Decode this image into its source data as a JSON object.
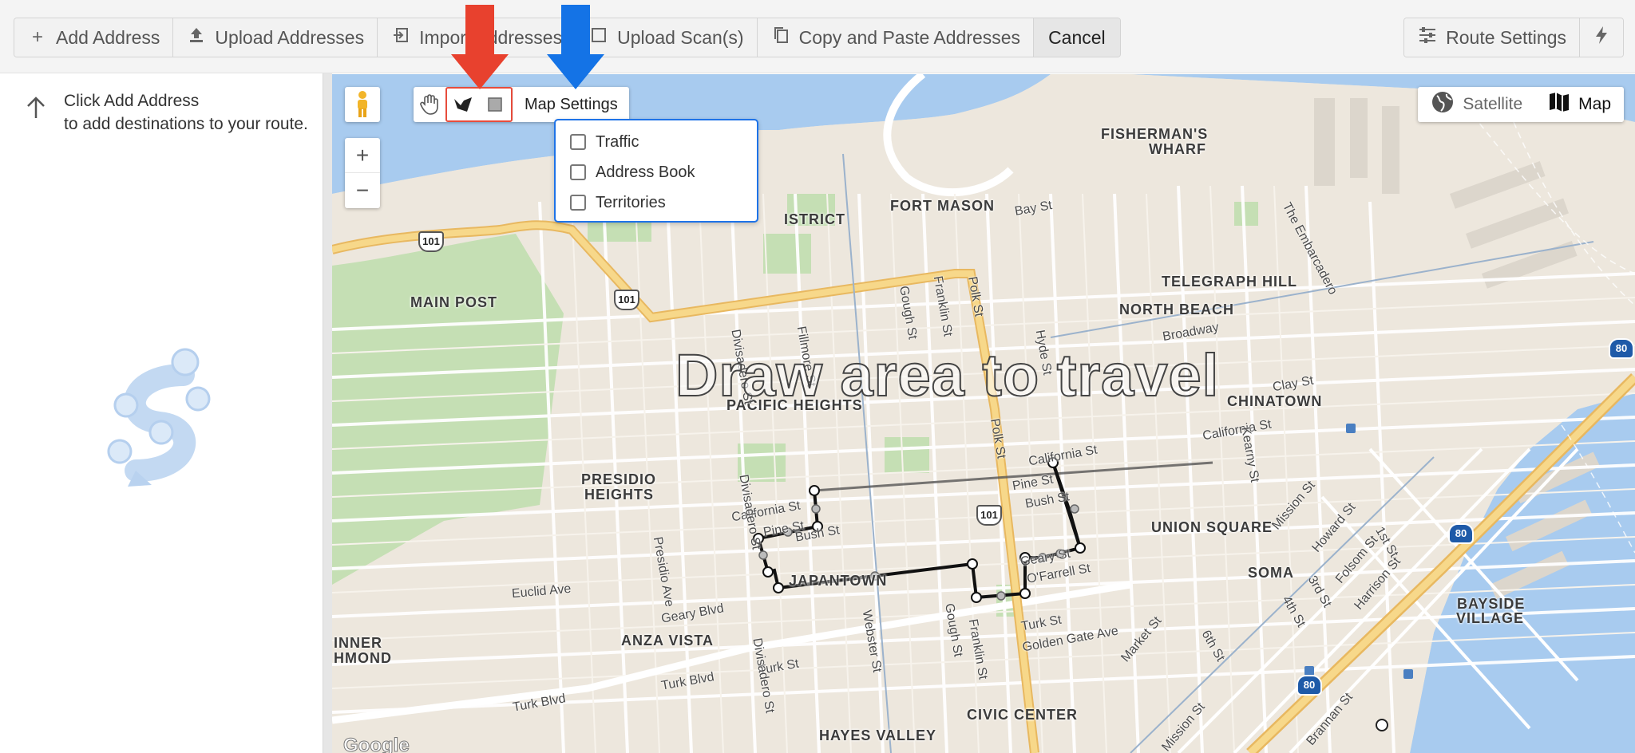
{
  "toolbar": {
    "add_address": "Add Address",
    "upload_addresses": "Upload Addresses",
    "import_addresses": "Import Addresses",
    "upload_scans": "Upload Scan(s)",
    "copy_paste": "Copy and Paste Addresses",
    "cancel": "Cancel",
    "route_settings": "Route Settings"
  },
  "left_panel": {
    "hint_line1": "Click Add Address",
    "hint_line2": "to add destinations to your route."
  },
  "map": {
    "overlay_text": "Draw area to travel",
    "map_settings": "Map Settings",
    "settings_options": [
      "Traffic",
      "Address Book",
      "Territories"
    ],
    "maptype_satellite": "Satellite",
    "maptype_map": "Map",
    "google": "Google",
    "neighborhoods": {
      "fishermans_wharf_1": "FISHERMAN'S",
      "fishermans_wharf_2": "WHARF",
      "fort_mason": "FORT MASON",
      "district": "ISTRICT",
      "telegraph_hill": "TELEGRAPH HILL",
      "north_beach": "NORTH BEACH",
      "main_post": "MAIN POST",
      "pacific_heights": "PACIFIC HEIGHTS",
      "chinatown": "CHINATOWN",
      "presidio_heights_1": "PRESIDIO",
      "presidio_heights_2": "HEIGHTS",
      "union_square": "UNION SQUARE",
      "soma": "SOMA",
      "japantown": "JAPANTOWN",
      "anza_vista": "ANZA VISTA",
      "bayside_village_1": "BAYSIDE",
      "bayside_village_2": "VILLAGE",
      "inner_richmond_1": "INNER",
      "inner_richmond_2": "HMOND",
      "civic_center": "CIVIC CENTER",
      "hayes_valley": "HAYES VALLEY"
    },
    "streets": {
      "bay_st": "Bay St",
      "broadway": "Broadway",
      "clay_st": "Clay St",
      "california_st_1": "California St",
      "california_st_2": "California St",
      "california_st_3": "California St",
      "pine_st_1": "Pine St",
      "pine_st_2": "Pine St",
      "bush_st_1": "Bush St",
      "bush_st_2": "Bush St",
      "geary_st": "Geary St",
      "ofarrell_st": "O'Farrell St",
      "geary_blvd": "Geary Blvd",
      "euclid_ave": "Euclid Ave",
      "turk_st_1": "Turk St",
      "turk_st_2": "Turk St",
      "turk_blvd": "Turk Blvd",
      "golden_gate_ave": "Golden Gate Ave",
      "polk_st_1": "Polk St",
      "polk_st_2": "Polk St",
      "franklin_st_1": "Franklin St",
      "franklin_st_2": "Franklin St",
      "gough_st_1": "Gough St",
      "gough_st_2": "Gough St",
      "fillmore_st": "Fillmore St",
      "divisadero_st_1": "Divisadero St",
      "divisadero_st_2": "Divisadero St",
      "divisadero_st_3": "Divisadero St",
      "presidio_ave": "Presidio Ave",
      "webster_st": "Webster St",
      "hyde_st": "Hyde St",
      "kearny_st": "Kearny St",
      "mission_st_1": "Mission St",
      "mission_st_2": "Mission St",
      "howard_st": "Howard St",
      "folsom_st": "Folsom St",
      "harrison_st": "Harrison St",
      "first_st": "1st St",
      "third_st": "3rd St",
      "fourth_st": "4th St",
      "sixth_st": "6th St",
      "market_st": "Market St",
      "brannan_st": "Brannan St",
      "embarcadero": "The Embarcadero"
    },
    "shields": {
      "us101_a": "101",
      "us101_b": "101",
      "us101_c": "101",
      "i80_a": "80",
      "i80_b": "80",
      "i80_c": "80"
    }
  },
  "colors": {
    "water": "#a8cbef",
    "land": "#ede7dd",
    "park": "#c5dfb4",
    "highway": "#f5cf7a",
    "highlight_red": "#e74c3c",
    "highlight_blue": "#1e73e8"
  }
}
